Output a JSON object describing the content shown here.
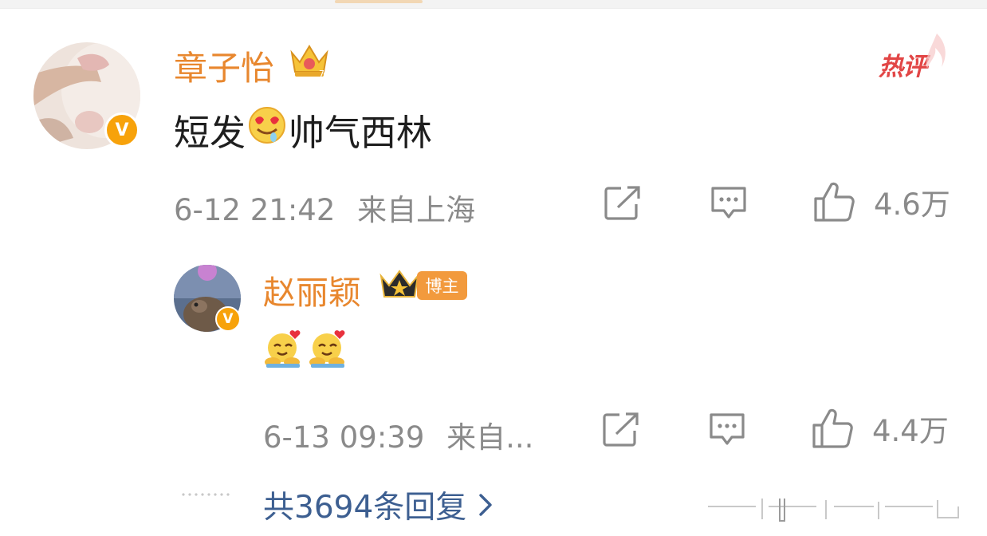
{
  "comment": {
    "author": "章子怡",
    "text_before_emoji": "短发",
    "text_after_emoji": "帅气西林",
    "date": "6-12 21:42",
    "location": "来自上海",
    "likes": "4.6万",
    "hot_badge": "热评"
  },
  "reply": {
    "author": "赵丽颖",
    "author_tag": "博主",
    "date": "6-13 09:39",
    "location": "来自...",
    "likes": "4.4万"
  },
  "replies_link": "共3694条回复",
  "icons": [
    "share-icon",
    "comment-icon",
    "like-icon",
    "crown-icon",
    "verified-icon",
    "emoji-icon",
    "chevron-right-icon"
  ],
  "colors": {
    "name": "#e8872e",
    "link": "#3d5f91",
    "meta": "#8a8a8a",
    "hot": "#e24646",
    "badge": "#f7a20b"
  }
}
